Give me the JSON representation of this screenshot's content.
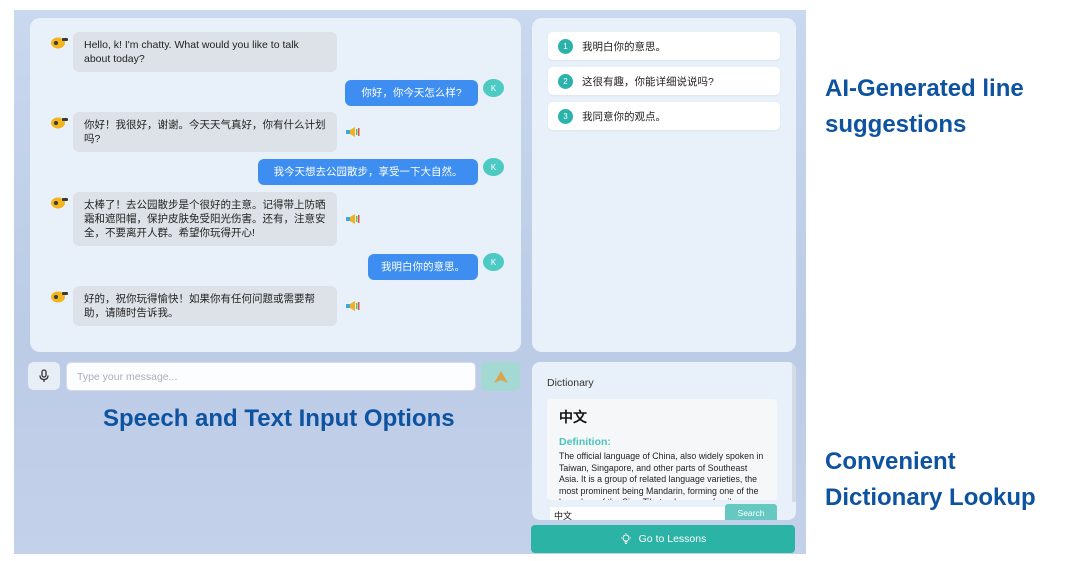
{
  "chat": {
    "messages": [
      {
        "role": "bot",
        "text": "Hello, k! I'm chatty. What would you like to talk about today?"
      },
      {
        "role": "user",
        "avatar": "K",
        "text": "你好，你今天怎么样?"
      },
      {
        "role": "bot",
        "text": "你好！我很好，谢谢。今天天气真好，你有什么计划吗?"
      },
      {
        "role": "user",
        "avatar": "K",
        "text": "我今天想去公园散步，享受一下大自然。"
      },
      {
        "role": "bot",
        "text": "太棒了！去公园散步是个很好的主意。记得带上防晒霜和遮阳帽，保护皮肤免受阳光伤害。还有，注意安全，不要离开人群。希望你玩得开心!"
      },
      {
        "role": "user",
        "avatar": "K",
        "text": "我明白你的意思。"
      },
      {
        "role": "bot",
        "text": "好的，祝你玩得愉快！如果你有任何问题或需要帮助，请随时告诉我。"
      }
    ]
  },
  "suggestions": [
    {
      "num": "1",
      "text": "我明白你的意思。"
    },
    {
      "num": "2",
      "text": "这很有趣，你能详细说说吗?"
    },
    {
      "num": "3",
      "text": "我同意你的观点。"
    }
  ],
  "input": {
    "placeholder": "Type your message..."
  },
  "dictionary": {
    "title": "Dictionary",
    "word": "中文",
    "definition_label": "Definition:",
    "definition": "The official language of China, also widely spoken in Taiwan, Singapore, and other parts of Southeast Asia. It is a group of related language varieties, the most prominent being Mandarin, forming one of the branches of the Sino-Tibetan language family.",
    "search_value": "中文",
    "search_label": "Search"
  },
  "lessons_button": "Go to Lessons",
  "captions": {
    "suggestions": "AI-Generated line suggestions",
    "input": "Speech and Text Input Options",
    "dictionary": "Convenient Dictionary Lookup"
  },
  "colors": {
    "accent_teal": "#2bb3a5",
    "user_bubble": "#3d8ef0",
    "caption_blue": "#0d53a0"
  },
  "icons": [
    "bot-avatar-icon",
    "speaker-icon",
    "microphone-icon",
    "send-icon",
    "lightbulb-icon"
  ]
}
